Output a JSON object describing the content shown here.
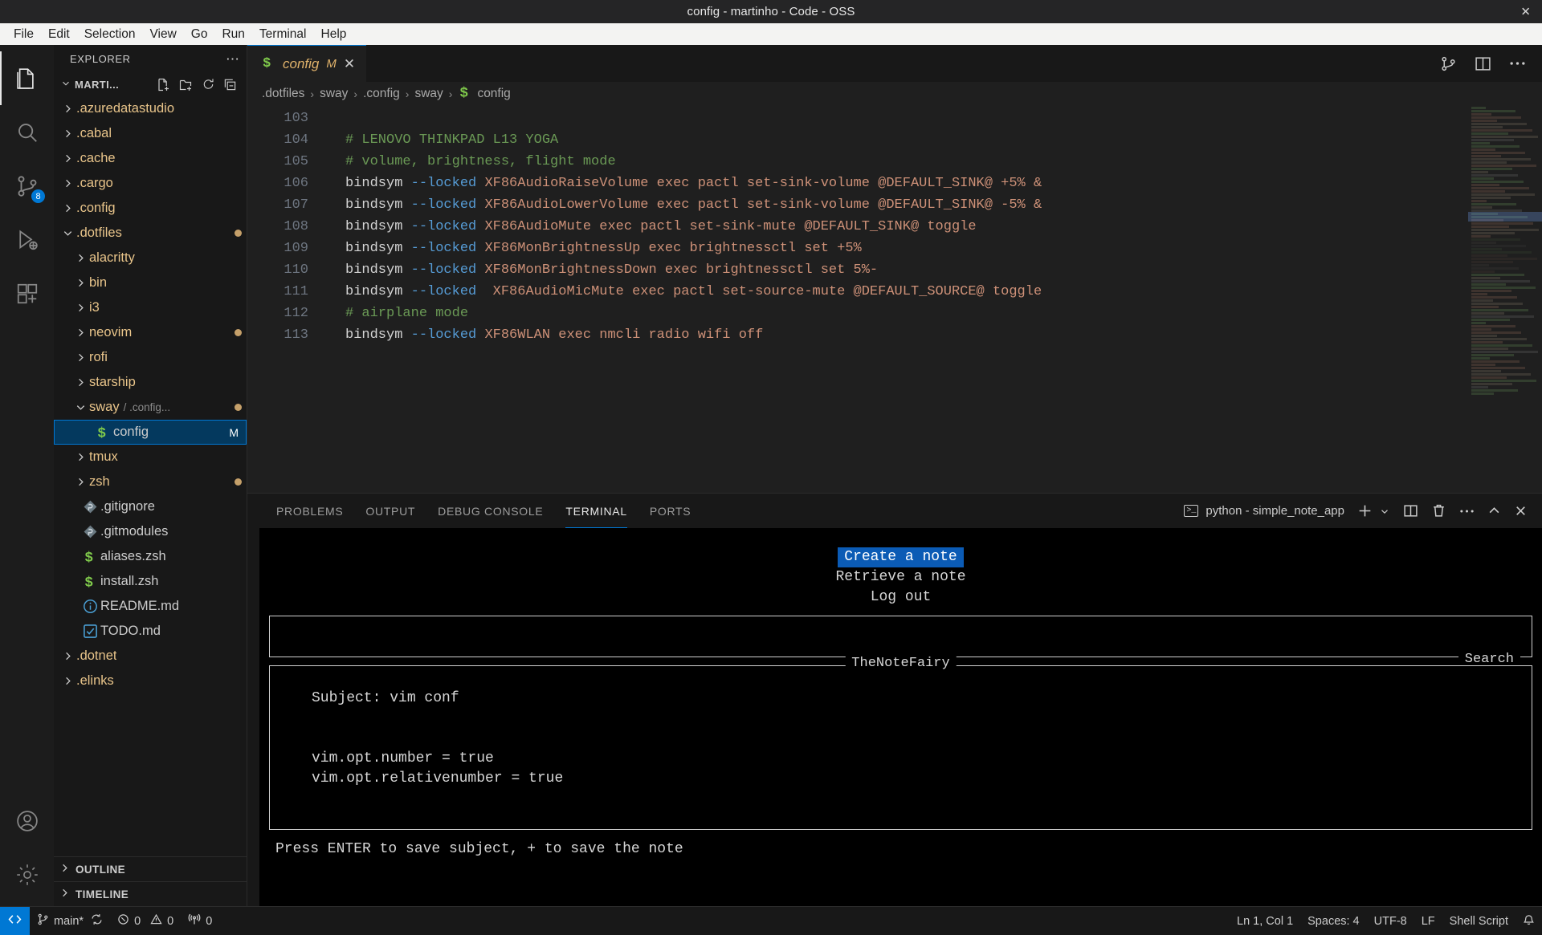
{
  "window": {
    "title": "config - martinho - Code - OSS",
    "close_label": "✕"
  },
  "menubar": {
    "items": [
      {
        "label": "File"
      },
      {
        "label": "Edit"
      },
      {
        "label": "Selection"
      },
      {
        "label": "View"
      },
      {
        "label": "Go"
      },
      {
        "label": "Run"
      },
      {
        "label": "Terminal"
      },
      {
        "label": "Help"
      }
    ]
  },
  "activitybar": {
    "items": [
      {
        "name": "explorer",
        "icon": "files-icon",
        "active": true,
        "badge": ""
      },
      {
        "name": "search",
        "icon": "search-icon",
        "active": false,
        "badge": ""
      },
      {
        "name": "source-control",
        "icon": "source-control-icon",
        "active": false,
        "badge": "8"
      },
      {
        "name": "run-debug",
        "icon": "run-and-debug-icon",
        "active": false,
        "badge": ""
      },
      {
        "name": "extensions",
        "icon": "extensions-icon",
        "active": false,
        "badge": ""
      }
    ],
    "bottom": [
      {
        "name": "accounts",
        "icon": "account-icon"
      },
      {
        "name": "manage",
        "icon": "gear-icon"
      }
    ]
  },
  "sidebar": {
    "title": "EXPLORER",
    "more_label": "⋯",
    "root": {
      "label": "MARTI...",
      "actions": [
        "new-file-icon",
        "new-folder-icon",
        "refresh-icon",
        "collapse-all-icon"
      ]
    },
    "tree": [
      {
        "label": ".azuredatastudio",
        "type": "folder",
        "indent": 0,
        "expanded": false,
        "dirty": false
      },
      {
        "label": ".cabal",
        "type": "folder",
        "indent": 0,
        "expanded": false,
        "dirty": false
      },
      {
        "label": ".cache",
        "type": "folder",
        "indent": 0,
        "expanded": false,
        "dirty": false
      },
      {
        "label": ".cargo",
        "type": "folder",
        "indent": 0,
        "expanded": false,
        "dirty": false
      },
      {
        "label": ".config",
        "type": "folder",
        "indent": 0,
        "expanded": false,
        "dirty": false
      },
      {
        "label": ".dotfiles",
        "type": "folder",
        "indent": 0,
        "expanded": true,
        "dirty": true
      },
      {
        "label": "alacritty",
        "type": "folder",
        "indent": 1,
        "expanded": false,
        "dirty": false
      },
      {
        "label": "bin",
        "type": "folder",
        "indent": 1,
        "expanded": false,
        "dirty": false
      },
      {
        "label": "i3",
        "type": "folder",
        "indent": 1,
        "expanded": false,
        "dirty": false
      },
      {
        "label": "neovim",
        "type": "folder",
        "indent": 1,
        "expanded": false,
        "dirty": true
      },
      {
        "label": "rofi",
        "type": "folder",
        "indent": 1,
        "expanded": false,
        "dirty": false
      },
      {
        "label": "starship",
        "type": "folder",
        "indent": 1,
        "expanded": false,
        "dirty": false
      },
      {
        "label": "sway",
        "sub": "/ .config...",
        "type": "folder",
        "indent": 1,
        "expanded": true,
        "dirty": true
      },
      {
        "label": "config",
        "type": "file",
        "icon": "shell-icon",
        "indent": 2,
        "selected": true,
        "badge": "M"
      },
      {
        "label": "tmux",
        "type": "folder",
        "indent": 1,
        "expanded": false,
        "dirty": false
      },
      {
        "label": "zsh",
        "type": "folder",
        "indent": 1,
        "expanded": false,
        "dirty": true
      },
      {
        "label": ".gitignore",
        "type": "file",
        "icon": "git-icon",
        "indent": 1
      },
      {
        "label": ".gitmodules",
        "type": "file",
        "icon": "git-icon",
        "indent": 1
      },
      {
        "label": "aliases.zsh",
        "type": "file",
        "icon": "shell-icon",
        "indent": 1
      },
      {
        "label": "install.zsh",
        "type": "file",
        "icon": "shell-icon",
        "indent": 1
      },
      {
        "label": "README.md",
        "type": "file",
        "icon": "info-icon",
        "indent": 1
      },
      {
        "label": "TODO.md",
        "type": "file",
        "icon": "checkbox-icon",
        "indent": 1
      },
      {
        "label": ".dotnet",
        "type": "folder",
        "indent": 0,
        "expanded": false,
        "dirty": false
      },
      {
        "label": ".elinks",
        "type": "folder",
        "indent": 0,
        "expanded": false,
        "dirty": false
      }
    ],
    "sections": [
      {
        "label": "OUTLINE"
      },
      {
        "label": "TIMELINE"
      }
    ]
  },
  "editor": {
    "tab": {
      "name": "config",
      "modified_badge": "M",
      "close_label": "✕",
      "icon": "shell-icon"
    },
    "tab_actions": [
      "split-editor-icon",
      "more-actions-icon",
      "source-control-graph-icon"
    ],
    "breadcrumb": [
      ".dotfiles",
      "sway",
      ".config",
      "sway",
      "config"
    ],
    "breadcrumb_sep": "›",
    "first_line": 103,
    "lines": [
      {
        "n": 103,
        "tokens": [
          {
            "t": "",
            "c": "ck"
          }
        ]
      },
      {
        "n": 104,
        "tokens": [
          {
            "t": "# LENOVO THINKPAD L13 YOGA",
            "c": "cm"
          }
        ]
      },
      {
        "n": 105,
        "tokens": [
          {
            "t": "# volume, brightness, flight mode",
            "c": "cm"
          }
        ]
      },
      {
        "n": 106,
        "tokens": [
          {
            "t": "bindsym ",
            "c": "ck"
          },
          {
            "t": "--locked",
            "c": "cf"
          },
          {
            "t": " XF86AudioRaiseVolume exec pactl set-sink-volume @DEFAULT_SINK@ +5% &",
            "c": "cs"
          }
        ]
      },
      {
        "n": 107,
        "tokens": [
          {
            "t": "bindsym ",
            "c": "ck"
          },
          {
            "t": "--locked",
            "c": "cf"
          },
          {
            "t": " XF86AudioLowerVolume exec pactl set-sink-volume @DEFAULT_SINK@ -5% &",
            "c": "cs"
          }
        ]
      },
      {
        "n": 108,
        "tokens": [
          {
            "t": "bindsym ",
            "c": "ck"
          },
          {
            "t": "--locked",
            "c": "cf"
          },
          {
            "t": " XF86AudioMute exec pactl set-sink-mute @DEFAULT_SINK@ toggle",
            "c": "cs"
          }
        ]
      },
      {
        "n": 109,
        "tokens": [
          {
            "t": "bindsym ",
            "c": "ck"
          },
          {
            "t": "--locked",
            "c": "cf"
          },
          {
            "t": " XF86MonBrightnessUp exec brightnessctl set +5%",
            "c": "cs"
          }
        ]
      },
      {
        "n": 110,
        "tokens": [
          {
            "t": "bindsym ",
            "c": "ck"
          },
          {
            "t": "--locked",
            "c": "cf"
          },
          {
            "t": " XF86MonBrightnessDown exec brightnessctl set 5%-",
            "c": "cs"
          }
        ]
      },
      {
        "n": 111,
        "tokens": [
          {
            "t": "bindsym ",
            "c": "ck"
          },
          {
            "t": "--locked",
            "c": "cf"
          },
          {
            "t": "  XF86AudioMicMute exec pactl set-source-mute @DEFAULT_SOURCE@ toggle",
            "c": "cs"
          }
        ]
      },
      {
        "n": 112,
        "tokens": [
          {
            "t": "# airplane mode",
            "c": "cm"
          }
        ]
      },
      {
        "n": 113,
        "tokens": [
          {
            "t": "bindsym ",
            "c": "ck"
          },
          {
            "t": "--locked",
            "c": "cf"
          },
          {
            "t": " XF86WLAN exec nmcli radio wifi off",
            "c": "cs"
          }
        ]
      }
    ]
  },
  "panel": {
    "tabs": [
      {
        "label": "PROBLEMS",
        "active": false
      },
      {
        "label": "OUTPUT",
        "active": false
      },
      {
        "label": "DEBUG CONSOLE",
        "active": false
      },
      {
        "label": "TERMINAL",
        "active": true
      },
      {
        "label": "PORTS",
        "active": false
      }
    ],
    "terminal_name": "python - simple_note_app",
    "terminal_icon": "terminal-icon",
    "actions": [
      {
        "name": "new-terminal-icon",
        "label": "+"
      },
      {
        "name": "chevron-down-icon",
        "label": "⌄"
      },
      {
        "name": "split-terminal-icon",
        "label": ""
      },
      {
        "name": "kill-terminal-icon",
        "label": ""
      },
      {
        "name": "more-actions-icon",
        "label": "⋯"
      },
      {
        "name": "maximize-panel-icon",
        "label": "⌃"
      },
      {
        "name": "close-panel-icon",
        "label": "✕"
      }
    ]
  },
  "terminal_app": {
    "menu": [
      {
        "label": "Create a note",
        "selected": true
      },
      {
        "label": "Retrieve a note",
        "selected": false
      },
      {
        "label": "Log out",
        "selected": false
      }
    ],
    "search_box_label": "Search",
    "search_box_value": "",
    "note_box_label": "TheNoteFairy",
    "note_lines": [
      "Subject: vim conf",
      "",
      "",
      "vim.opt.number = true",
      "vim.opt.relativenumber = true"
    ],
    "hint": "Press ENTER to save subject, + to save the note"
  },
  "statusbar": {
    "remote_label": "",
    "branch": "main*",
    "sync_icon": "sync-icon",
    "errors": "0",
    "warnings": "0",
    "ports": "0",
    "cursor_position": "Ln 1, Col 1",
    "indentation": "Spaces: 4",
    "encoding": "UTF-8",
    "eol": "LF",
    "language": "Shell Script",
    "bell_icon": "bell-icon"
  },
  "colors": {
    "accent": "#0078d4",
    "selection": "#04395e",
    "folder_text": "#e8c48a",
    "dirty_dot": "#c5a06a",
    "comment": "#6a9955",
    "string": "#ce9178",
    "flag": "#569cd6",
    "titlebar_bg": "#252526",
    "menubar_bg": "#f3f3f2",
    "sidebar_bg": "#181818",
    "editor_bg": "#1f1f1f",
    "terminal_bg": "#000000",
    "tui_selected_bg": "#0b5bb5"
  }
}
